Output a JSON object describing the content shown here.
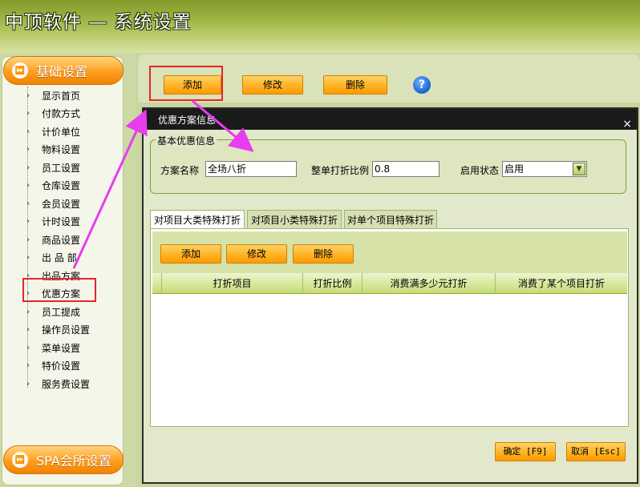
{
  "header": {
    "title": "中顶软件 — 系统设置"
  },
  "sidebar": {
    "category_basic": "基础设置",
    "category_spa": "SPA会所设置",
    "items": [
      {
        "label": "显示首页"
      },
      {
        "label": "付款方式"
      },
      {
        "label": "计价单位"
      },
      {
        "label": "物料设置"
      },
      {
        "label": "员工设置"
      },
      {
        "label": "仓库设置"
      },
      {
        "label": "会员设置"
      },
      {
        "label": "计时设置"
      },
      {
        "label": "商品设置"
      },
      {
        "label": "出 品 部"
      },
      {
        "label": "出品方案"
      },
      {
        "label": "优惠方案",
        "active": true
      },
      {
        "label": "员工提成"
      },
      {
        "label": "操作员设置"
      },
      {
        "label": "菜单设置"
      },
      {
        "label": "特价设置"
      },
      {
        "label": "服务费设置"
      }
    ]
  },
  "toolbar": {
    "add": "添加",
    "edit": "修改",
    "delete": "删除",
    "help_icon": "question-icon"
  },
  "dialog": {
    "title": "优惠方案信息",
    "close": "×",
    "group_title": "基本优惠信息",
    "name_label": "方案名称",
    "name_value": "全场八折",
    "discount_label": "整单打折比例",
    "discount_value": "0.8",
    "status_label": "启用状态",
    "status_value": "启用",
    "tabs": [
      {
        "label": "对项目大类特殊打折",
        "active": true
      },
      {
        "label": "对项目小类特殊打折"
      },
      {
        "label": "对单个项目特殊打折"
      }
    ],
    "inner_toolbar": {
      "add": "添加",
      "edit": "修改",
      "delete": "删除"
    },
    "columns": [
      "打折项目",
      "打折比例",
      "消费满多少元打折",
      "消费了某个项目打折"
    ],
    "ok": "确定 [F9]",
    "cancel": "取消 [Esc]"
  },
  "colors": {
    "accent_orange": "#ff9a00",
    "header_green": "#7f9a29",
    "highlight_red": "#e8242b",
    "annotation_arrow": "#e83cf0"
  }
}
